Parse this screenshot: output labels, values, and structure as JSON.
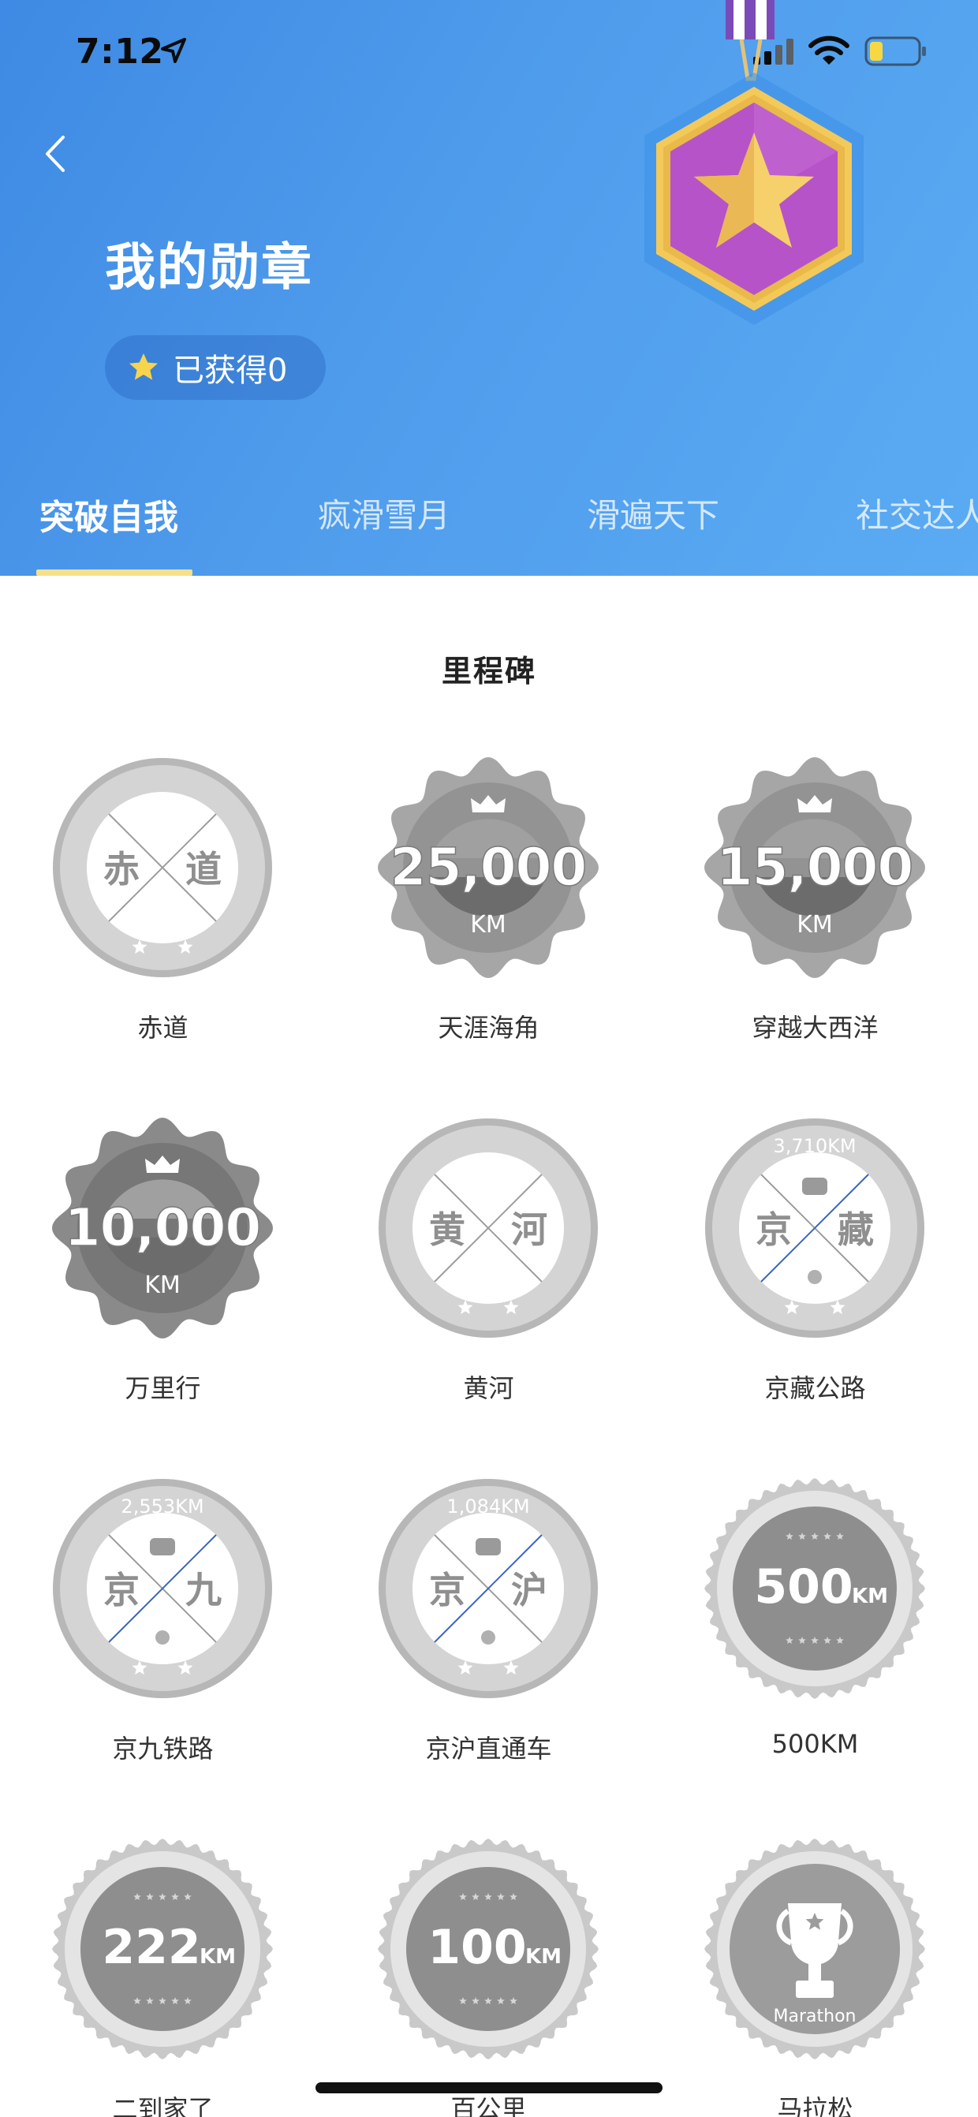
{
  "status_bar": {
    "time": "7:12"
  },
  "header": {
    "title": "我的勋章",
    "earned_label": "已获得0"
  },
  "tabs": [
    {
      "label": "突破自我",
      "active": true
    },
    {
      "label": "疯滑雪月",
      "active": false
    },
    {
      "label": "滑遍天下",
      "active": false
    },
    {
      "label": "社交达人",
      "active": false
    }
  ],
  "section": {
    "title": "里程碑"
  },
  "badges": [
    {
      "name": "赤道",
      "kind": "route",
      "left": "赤",
      "right": "道"
    },
    {
      "name": "天涯海角",
      "kind": "crown",
      "value": "25,000",
      "unit": "KM"
    },
    {
      "name": "穿越大西洋",
      "kind": "crown",
      "value": "15,000",
      "unit": "KM"
    },
    {
      "name": "万里行",
      "kind": "crown",
      "value": "10,000",
      "unit": "KM"
    },
    {
      "name": "黄河",
      "kind": "route",
      "left": "黄",
      "right": "河"
    },
    {
      "name": "京藏公路",
      "kind": "route",
      "left": "京",
      "right": "藏",
      "distance": "3,710KM"
    },
    {
      "name": "京九铁路",
      "kind": "route",
      "left": "京",
      "right": "九",
      "distance": "2,553KM"
    },
    {
      "name": "京沪直通车",
      "kind": "route",
      "left": "京",
      "right": "沪",
      "distance": "1,084KM"
    },
    {
      "name": "500KM",
      "kind": "stamp",
      "value": "500",
      "unit": "KM"
    },
    {
      "name": "二到家了",
      "kind": "stamp",
      "value": "222",
      "unit": "KM"
    },
    {
      "name": "百公里",
      "kind": "stamp",
      "value": "100",
      "unit": "KM"
    },
    {
      "name": "马拉松",
      "kind": "trophy",
      "label": "Marathon"
    }
  ],
  "colors": {
    "header_gradient_start": "#3e8ae4",
    "header_gradient_end": "#5aabf3",
    "tab_indicator": "#f7e08a",
    "badge_gray_dark": "#8e8e8e",
    "badge_gray_mid": "#bdbdbd",
    "badge_gray_light": "#e3e3e3",
    "star_yellow": "#f7d44c",
    "medal_purple": "#b653c9"
  }
}
